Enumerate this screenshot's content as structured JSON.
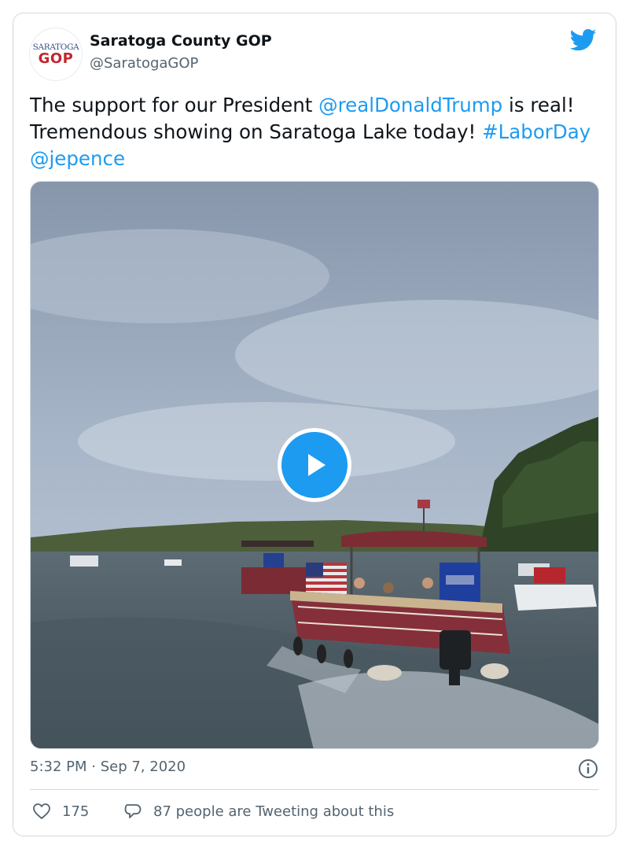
{
  "account": {
    "avatar_line1": "SARATOGA",
    "avatar_line2": "GOP",
    "display_name": "Saratoga County GOP",
    "handle": "@SaratogaGOP"
  },
  "tweet": {
    "text_1": "The support for our President ",
    "mention_1": "@realDonaldTrump",
    "text_2": " is real! Tremendous showing on Saratoga Lake today! ",
    "hashtag": "#LaborDay",
    "text_3": " ",
    "mention_2": "@jepence"
  },
  "media": {
    "type": "video",
    "play_icon": "play-icon"
  },
  "meta": {
    "timestamp": "5:32 PM · Sep 7, 2020"
  },
  "actions": {
    "likes": "175",
    "replies_text": "87 people are Tweeting about this"
  },
  "colors": {
    "accent": "#1d9bf0",
    "text": "#0f1419",
    "muted": "#536471",
    "border": "#cfd9de"
  },
  "icons": [
    "twitter-bird-icon",
    "play-icon",
    "info-icon",
    "heart-icon",
    "reply-bubble-icon"
  ]
}
